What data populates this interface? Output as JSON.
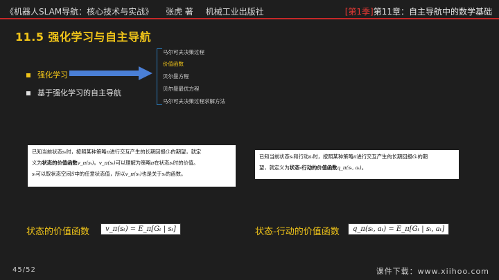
{
  "header": {
    "book": "《机器人SLAM导航：核心技术与实战》",
    "author": "张虎 著",
    "publisher": "机械工业出版社",
    "season": "[第1季]",
    "chapter": "第11章：自主导航中的数学基础"
  },
  "section_title": "11.5 强化学习与自主导航",
  "bullets": [
    {
      "label": "强化学习",
      "active": true
    },
    {
      "label": "基于强化学习的自主导航",
      "active": false
    }
  ],
  "subtopics": [
    {
      "label": "马尔可夫决策过程",
      "active": false
    },
    {
      "label": "价值函数",
      "active": true
    },
    {
      "label": "贝尔曼方程",
      "active": false
    },
    {
      "label": "贝尔曼最优方程",
      "active": false
    },
    {
      "label": "马尔可夫决策过程求解方法",
      "active": false
    }
  ],
  "state_value_box": {
    "t1": "已知当前状态",
    "s_t": "sₜ",
    "t2": "时，按照某种策略",
    "pi": "π",
    "t3": "进行交互产生的长期回报",
    "G_t": "Gₜ",
    "t4": "的期望，就定",
    "t5": "义为",
    "bold": "状态的价值函数",
    "v": "v_π(sₜ)",
    "t6": "。",
    "v2": "v_π(sₜ)",
    "t7": "可以理解为策略",
    "pi2": "π",
    "t8": "在状态",
    "s_t2": "sₜ",
    "t9": "时的价值。",
    "s_t3": "sₜ",
    "t10": "可以取状态空间",
    "S": "S",
    "t11": "中的任意状态值，所以",
    "v3": "v_π(sₜ)",
    "t12": "也是关于",
    "s_t4": "sₜ",
    "t13": "的函数。"
  },
  "action_value_box": {
    "t1": "已知当前状态",
    "s_t": "sₜ",
    "t2": "和行动",
    "a_t": "aₜ",
    "t3": "时，按照某种策略",
    "pi": "π",
    "t4": "进行交互产生的长期回报",
    "G_t": "Gₜ",
    "t5": "的期",
    "t6": "望，就定义为",
    "bold": "状态-行动的价值函数",
    "q": "q_π(sₜ, aₜ)",
    "t7": "。"
  },
  "state_value_label": "状态的价值函数",
  "state_value_formula": "v_π(sₜ) = E_π[Gₜ | sₜ]",
  "action_value_label": "状态-行动的价值函数",
  "action_value_formula": "q_π(sₜ, aₜ) = E_π[Gₜ | sₜ, aₜ]",
  "footer": {
    "page": "45/52",
    "download": "课件下载：www.xiihoo.com"
  },
  "colors": {
    "accent": "#f0c419",
    "season_red": "#e53935",
    "rule_red": "#c62828",
    "arrow_blue": "#4a7fd6",
    "background": "#1e1e1e"
  }
}
